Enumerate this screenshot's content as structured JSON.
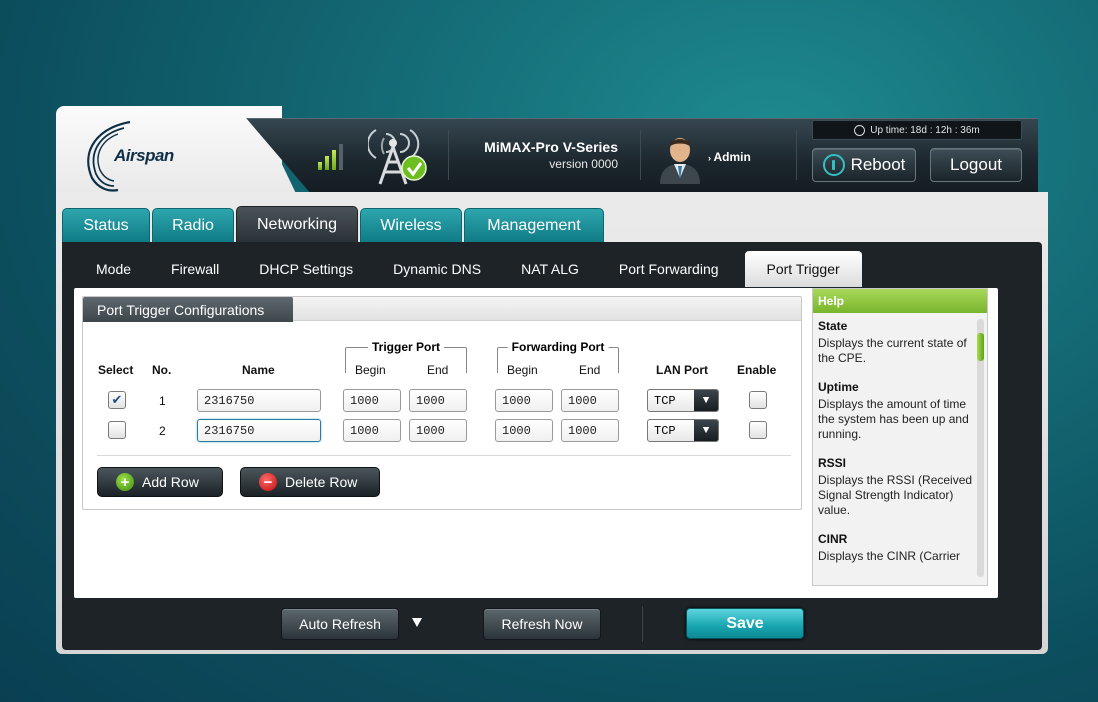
{
  "brand": {
    "logo_text": "Airspan"
  },
  "device": {
    "model": "MiMAX-Pro V-Series",
    "version": "version 0000"
  },
  "user": {
    "name": "Admin"
  },
  "status": {
    "uptime": "Up time: 18d : 12h : 36m",
    "signal_level": 3,
    "signal_max": 4
  },
  "header_buttons": {
    "reboot": "Reboot",
    "logout": "Logout"
  },
  "main_tabs": [
    "Status",
    "Radio",
    "Networking",
    "Wireless",
    "Management"
  ],
  "main_tab_active": "Networking",
  "sub_tabs": [
    "Mode",
    "Firewall",
    "DHCP Settings",
    "Dynamic DNS",
    "NAT ALG",
    "Port Forwarding",
    "Port Trigger"
  ],
  "sub_tab_active": "Port Trigger",
  "config": {
    "title": "Port Trigger Configurations",
    "headers": {
      "select": "Select",
      "no": "No.",
      "name": "Name",
      "trigger_port": "Trigger Port",
      "forwarding_port": "Forwarding Port",
      "begin": "Begin",
      "end": "End",
      "lan_port": "LAN Port",
      "enable": "Enable"
    },
    "rows": [
      {
        "selected": true,
        "no": "1",
        "name": "2316750",
        "trigger_begin": "1000",
        "trigger_end": "1000",
        "fwd_begin": "1000",
        "fwd_end": "1000",
        "lan_port": "TCP",
        "enabled": false
      },
      {
        "selected": false,
        "no": "2",
        "name": "2316750",
        "trigger_begin": "1000",
        "trigger_end": "1000",
        "fwd_begin": "1000",
        "fwd_end": "1000",
        "lan_port": "TCP",
        "enabled": false
      }
    ],
    "add_row": "Add Row",
    "delete_row": "Delete Row"
  },
  "help": {
    "title": "Help",
    "items": [
      {
        "title": "State",
        "desc": "Displays the current state of the CPE."
      },
      {
        "title": "Uptime",
        "desc": "Displays the amount of time the system has been up and running."
      },
      {
        "title": "RSSI",
        "desc": "Displays the RSSI (Received Signal Strength Indicator) value."
      },
      {
        "title": "CINR",
        "desc": "Displays the CINR (Carrier"
      }
    ]
  },
  "footer": {
    "auto_refresh": "Auto Refresh",
    "refresh_now": "Refresh Now",
    "save": "Save"
  },
  "colors": {
    "accent": "#16a4af",
    "help_header": "#8cc63f",
    "active_tab": "#2a3237"
  }
}
